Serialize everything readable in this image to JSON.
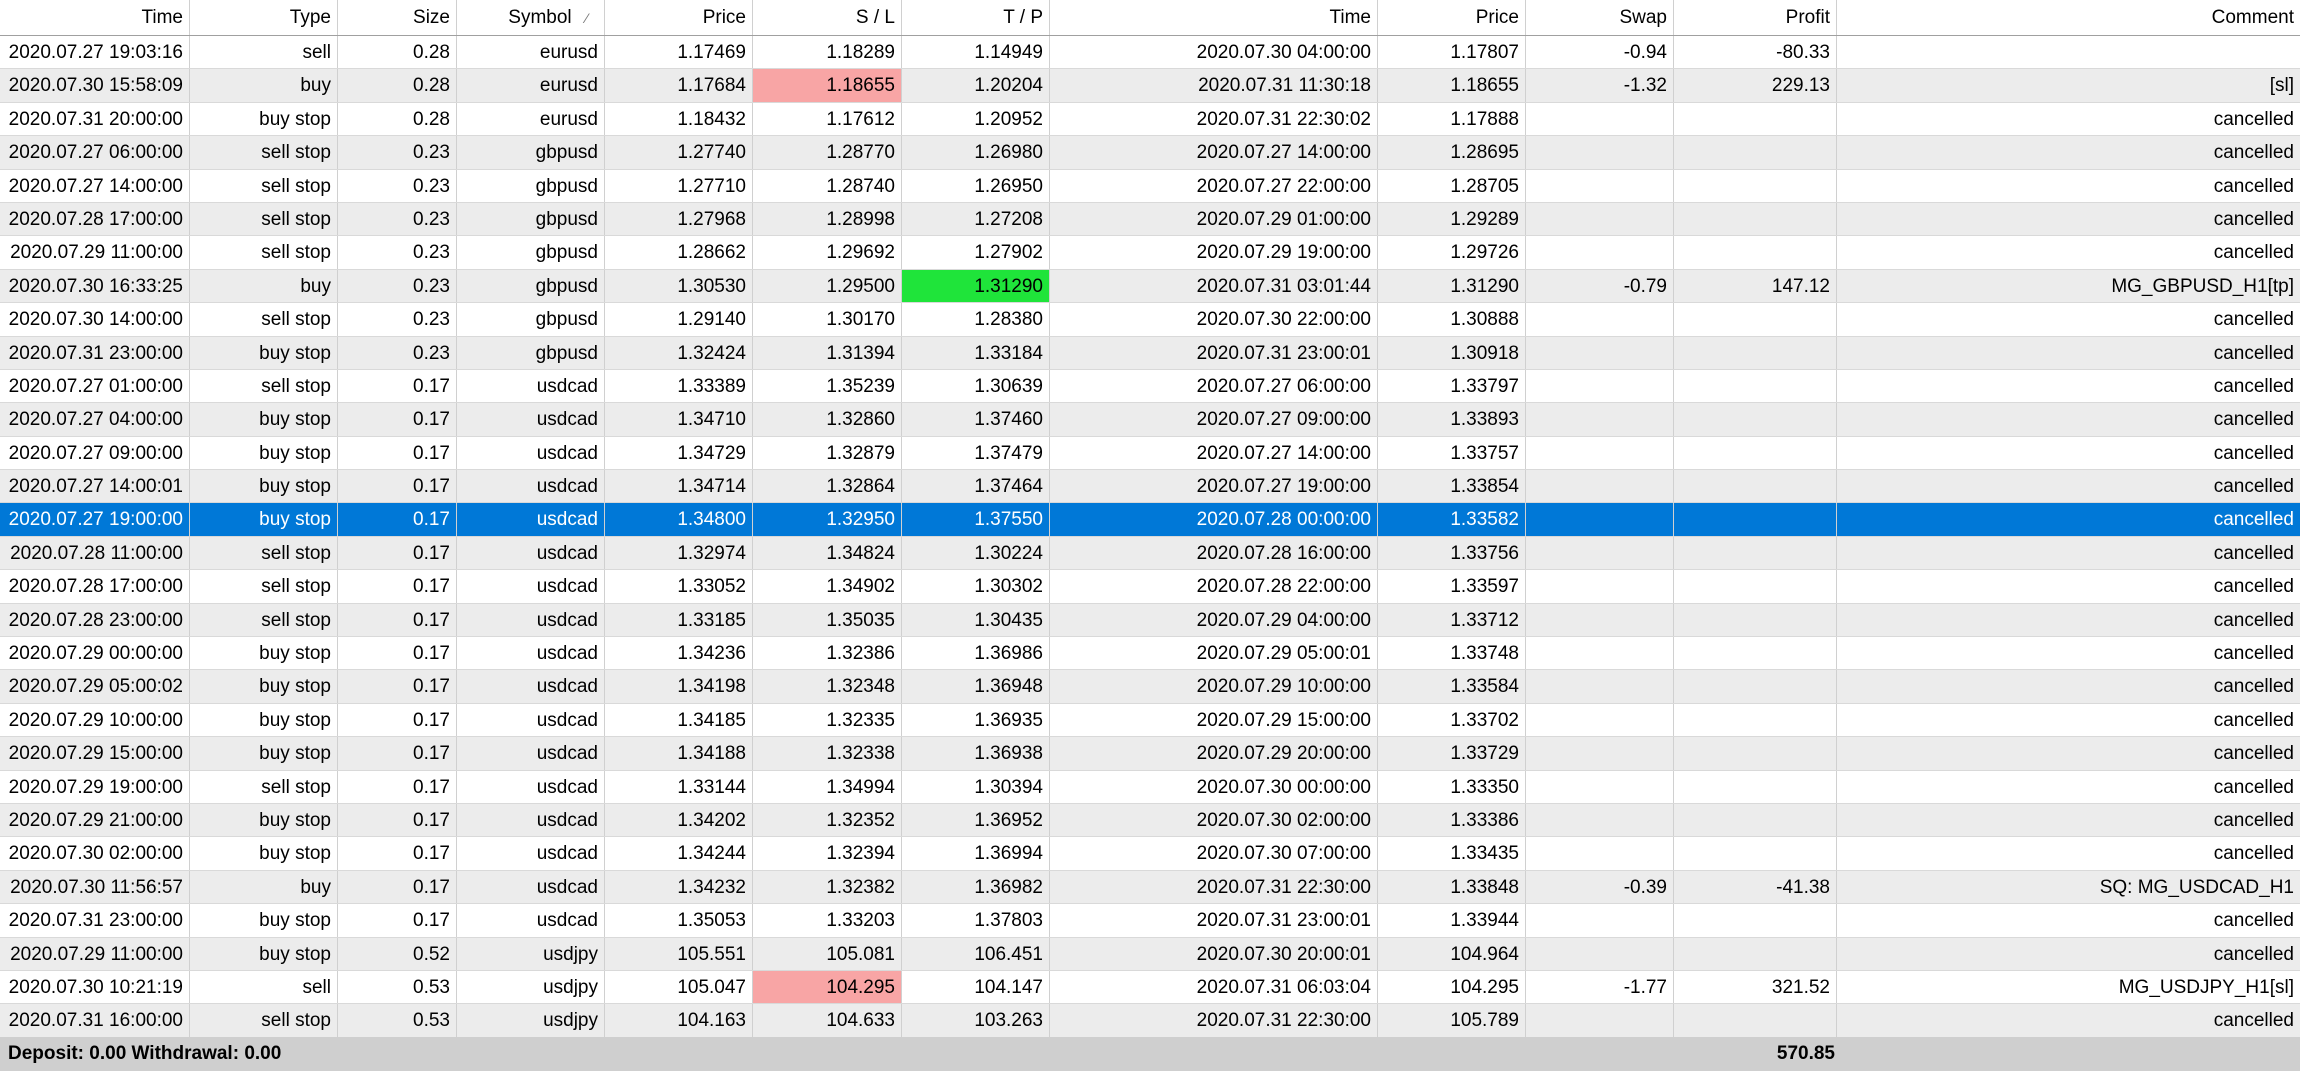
{
  "columns": [
    "Time",
    "Type",
    "Size",
    "Symbol",
    "Price",
    "S / L",
    "T / P",
    "Time",
    "Price",
    "Swap",
    "Profit",
    "Comment"
  ],
  "sort_indicator": "⁄",
  "colors": {
    "selection": "#0078d7",
    "sl_highlight": "#f8a5a5",
    "tp_highlight": "#1fe43a",
    "alt_row": "#ececec",
    "footer": "#cfcfcf"
  },
  "rows": [
    {
      "cells": [
        "2020.07.27 19:03:16",
        "sell",
        "0.28",
        "eurusd",
        "1.17469",
        "1.18289",
        "1.14949",
        "2020.07.30 04:00:00",
        "1.17807",
        "-0.94",
        "-80.33",
        ""
      ],
      "hl": ""
    },
    {
      "cells": [
        "2020.07.30 15:58:09",
        "buy",
        "0.28",
        "eurusd",
        "1.17684",
        "1.18655",
        "1.20204",
        "2020.07.31 11:30:18",
        "1.18655",
        "-1.32",
        "229.13",
        "[sl]"
      ],
      "hl": "sl"
    },
    {
      "cells": [
        "2020.07.31 20:00:00",
        "buy stop",
        "0.28",
        "eurusd",
        "1.18432",
        "1.17612",
        "1.20952",
        "2020.07.31 22:30:02",
        "1.17888",
        "",
        "",
        "cancelled"
      ],
      "hl": ""
    },
    {
      "cells": [
        "2020.07.27 06:00:00",
        "sell stop",
        "0.23",
        "gbpusd",
        "1.27740",
        "1.28770",
        "1.26980",
        "2020.07.27 14:00:00",
        "1.28695",
        "",
        "",
        "cancelled"
      ],
      "hl": ""
    },
    {
      "cells": [
        "2020.07.27 14:00:00",
        "sell stop",
        "0.23",
        "gbpusd",
        "1.27710",
        "1.28740",
        "1.26950",
        "2020.07.27 22:00:00",
        "1.28705",
        "",
        "",
        "cancelled"
      ],
      "hl": ""
    },
    {
      "cells": [
        "2020.07.28 17:00:00",
        "sell stop",
        "0.23",
        "gbpusd",
        "1.27968",
        "1.28998",
        "1.27208",
        "2020.07.29 01:00:00",
        "1.29289",
        "",
        "",
        "cancelled"
      ],
      "hl": ""
    },
    {
      "cells": [
        "2020.07.29 11:00:00",
        "sell stop",
        "0.23",
        "gbpusd",
        "1.28662",
        "1.29692",
        "1.27902",
        "2020.07.29 19:00:00",
        "1.29726",
        "",
        "",
        "cancelled"
      ],
      "hl": ""
    },
    {
      "cells": [
        "2020.07.30 16:33:25",
        "buy",
        "0.23",
        "gbpusd",
        "1.30530",
        "1.29500",
        "1.31290",
        "2020.07.31 03:01:44",
        "1.31290",
        "-0.79",
        "147.12",
        "MG_GBPUSD_H1[tp]"
      ],
      "hl": "tp"
    },
    {
      "cells": [
        "2020.07.30 14:00:00",
        "sell stop",
        "0.23",
        "gbpusd",
        "1.29140",
        "1.30170",
        "1.28380",
        "2020.07.30 22:00:00",
        "1.30888",
        "",
        "",
        "cancelled"
      ],
      "hl": ""
    },
    {
      "cells": [
        "2020.07.31 23:00:00",
        "buy stop",
        "0.23",
        "gbpusd",
        "1.32424",
        "1.31394",
        "1.33184",
        "2020.07.31 23:00:01",
        "1.30918",
        "",
        "",
        "cancelled"
      ],
      "hl": ""
    },
    {
      "cells": [
        "2020.07.27 01:00:00",
        "sell stop",
        "0.17",
        "usdcad",
        "1.33389",
        "1.35239",
        "1.30639",
        "2020.07.27 06:00:00",
        "1.33797",
        "",
        "",
        "cancelled"
      ],
      "hl": ""
    },
    {
      "cells": [
        "2020.07.27 04:00:00",
        "buy stop",
        "0.17",
        "usdcad",
        "1.34710",
        "1.32860",
        "1.37460",
        "2020.07.27 09:00:00",
        "1.33893",
        "",
        "",
        "cancelled"
      ],
      "hl": ""
    },
    {
      "cells": [
        "2020.07.27 09:00:00",
        "buy stop",
        "0.17",
        "usdcad",
        "1.34729",
        "1.32879",
        "1.37479",
        "2020.07.27 14:00:00",
        "1.33757",
        "",
        "",
        "cancelled"
      ],
      "hl": ""
    },
    {
      "cells": [
        "2020.07.27 14:00:01",
        "buy stop",
        "0.17",
        "usdcad",
        "1.34714",
        "1.32864",
        "1.37464",
        "2020.07.27 19:00:00",
        "1.33854",
        "",
        "",
        "cancelled"
      ],
      "hl": ""
    },
    {
      "cells": [
        "2020.07.27 19:00:00",
        "buy stop",
        "0.17",
        "usdcad",
        "1.34800",
        "1.32950",
        "1.37550",
        "2020.07.28 00:00:00",
        "1.33582",
        "",
        "",
        "cancelled"
      ],
      "hl": "",
      "selected": true
    },
    {
      "cells": [
        "2020.07.28 11:00:00",
        "sell stop",
        "0.17",
        "usdcad",
        "1.32974",
        "1.34824",
        "1.30224",
        "2020.07.28 16:00:00",
        "1.33756",
        "",
        "",
        "cancelled"
      ],
      "hl": ""
    },
    {
      "cells": [
        "2020.07.28 17:00:00",
        "sell stop",
        "0.17",
        "usdcad",
        "1.33052",
        "1.34902",
        "1.30302",
        "2020.07.28 22:00:00",
        "1.33597",
        "",
        "",
        "cancelled"
      ],
      "hl": ""
    },
    {
      "cells": [
        "2020.07.28 23:00:00",
        "sell stop",
        "0.17",
        "usdcad",
        "1.33185",
        "1.35035",
        "1.30435",
        "2020.07.29 04:00:00",
        "1.33712",
        "",
        "",
        "cancelled"
      ],
      "hl": ""
    },
    {
      "cells": [
        "2020.07.29 00:00:00",
        "buy stop",
        "0.17",
        "usdcad",
        "1.34236",
        "1.32386",
        "1.36986",
        "2020.07.29 05:00:01",
        "1.33748",
        "",
        "",
        "cancelled"
      ],
      "hl": ""
    },
    {
      "cells": [
        "2020.07.29 05:00:02",
        "buy stop",
        "0.17",
        "usdcad",
        "1.34198",
        "1.32348",
        "1.36948",
        "2020.07.29 10:00:00",
        "1.33584",
        "",
        "",
        "cancelled"
      ],
      "hl": ""
    },
    {
      "cells": [
        "2020.07.29 10:00:00",
        "buy stop",
        "0.17",
        "usdcad",
        "1.34185",
        "1.32335",
        "1.36935",
        "2020.07.29 15:00:00",
        "1.33702",
        "",
        "",
        "cancelled"
      ],
      "hl": ""
    },
    {
      "cells": [
        "2020.07.29 15:00:00",
        "buy stop",
        "0.17",
        "usdcad",
        "1.34188",
        "1.32338",
        "1.36938",
        "2020.07.29 20:00:00",
        "1.33729",
        "",
        "",
        "cancelled"
      ],
      "hl": ""
    },
    {
      "cells": [
        "2020.07.29 19:00:00",
        "sell stop",
        "0.17",
        "usdcad",
        "1.33144",
        "1.34994",
        "1.30394",
        "2020.07.30 00:00:00",
        "1.33350",
        "",
        "",
        "cancelled"
      ],
      "hl": ""
    },
    {
      "cells": [
        "2020.07.29 21:00:00",
        "buy stop",
        "0.17",
        "usdcad",
        "1.34202",
        "1.32352",
        "1.36952",
        "2020.07.30 02:00:00",
        "1.33386",
        "",
        "",
        "cancelled"
      ],
      "hl": ""
    },
    {
      "cells": [
        "2020.07.30 02:00:00",
        "buy stop",
        "0.17",
        "usdcad",
        "1.34244",
        "1.32394",
        "1.36994",
        "2020.07.30 07:00:00",
        "1.33435",
        "",
        "",
        "cancelled"
      ],
      "hl": ""
    },
    {
      "cells": [
        "2020.07.30 11:56:57",
        "buy",
        "0.17",
        "usdcad",
        "1.34232",
        "1.32382",
        "1.36982",
        "2020.07.31 22:30:00",
        "1.33848",
        "-0.39",
        "-41.38",
        "SQ: MG_USDCAD_H1"
      ],
      "hl": ""
    },
    {
      "cells": [
        "2020.07.31 23:00:00",
        "buy stop",
        "0.17",
        "usdcad",
        "1.35053",
        "1.33203",
        "1.37803",
        "2020.07.31 23:00:01",
        "1.33944",
        "",
        "",
        "cancelled"
      ],
      "hl": ""
    },
    {
      "cells": [
        "2020.07.29 11:00:00",
        "buy stop",
        "0.52",
        "usdjpy",
        "105.551",
        "105.081",
        "106.451",
        "2020.07.30 20:00:01",
        "104.964",
        "",
        "",
        "cancelled"
      ],
      "hl": ""
    },
    {
      "cells": [
        "2020.07.30 10:21:19",
        "sell",
        "0.53",
        "usdjpy",
        "105.047",
        "104.295",
        "104.147",
        "2020.07.31 06:03:04",
        "104.295",
        "-1.77",
        "321.52",
        "MG_USDJPY_H1[sl]"
      ],
      "hl": "sl"
    },
    {
      "cells": [
        "2020.07.31 16:00:00",
        "sell stop",
        "0.53",
        "usdjpy",
        "104.163",
        "104.633",
        "103.263",
        "2020.07.31 22:30:00",
        "105.789",
        "",
        "",
        "cancelled"
      ],
      "hl": ""
    }
  ],
  "footer": {
    "summary": "Deposit: 0.00  Withdrawal: 0.00",
    "total_profit": "570.85"
  }
}
